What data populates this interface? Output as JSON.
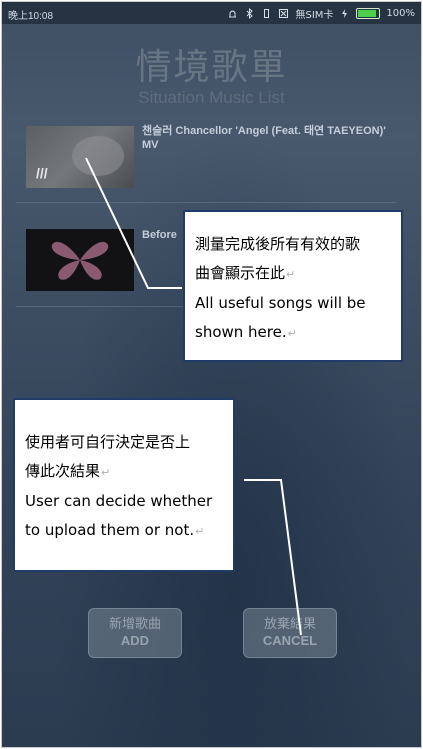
{
  "status_bar": {
    "time": "晚上10:08",
    "sim": "無SIM卡",
    "battery": "100%",
    "battery_level": 1.0
  },
  "header": {
    "title_cn": "情境歌單",
    "title_en": "Situation Music List"
  },
  "songs": [
    {
      "title": "챈슬러 Chancellor 'Angel (Feat. 태연 TAEYEON)' MV"
    },
    {
      "title": "Before"
    }
  ],
  "annotations": {
    "songs_note": {
      "line1": "測量完成後所有有效的歌",
      "line2": "曲會顯示在此",
      "line3": "All useful songs will be",
      "line4": "shown here."
    },
    "upload_note": {
      "line1": "使用者可自行決定是否上",
      "line2": "傳此次結果",
      "line3": "User can decide whether",
      "line4": "to upload them or not."
    }
  },
  "buttons": {
    "add": {
      "cn": "新增歌曲",
      "en": "ADD"
    },
    "cancel": {
      "cn": "放棄結果",
      "en": "CANCEL"
    }
  },
  "colors": {
    "background": "#3d4d62",
    "status_bar": "#263342",
    "callout_border": "#1f3b66",
    "battery_fill": "#4cd04c"
  }
}
